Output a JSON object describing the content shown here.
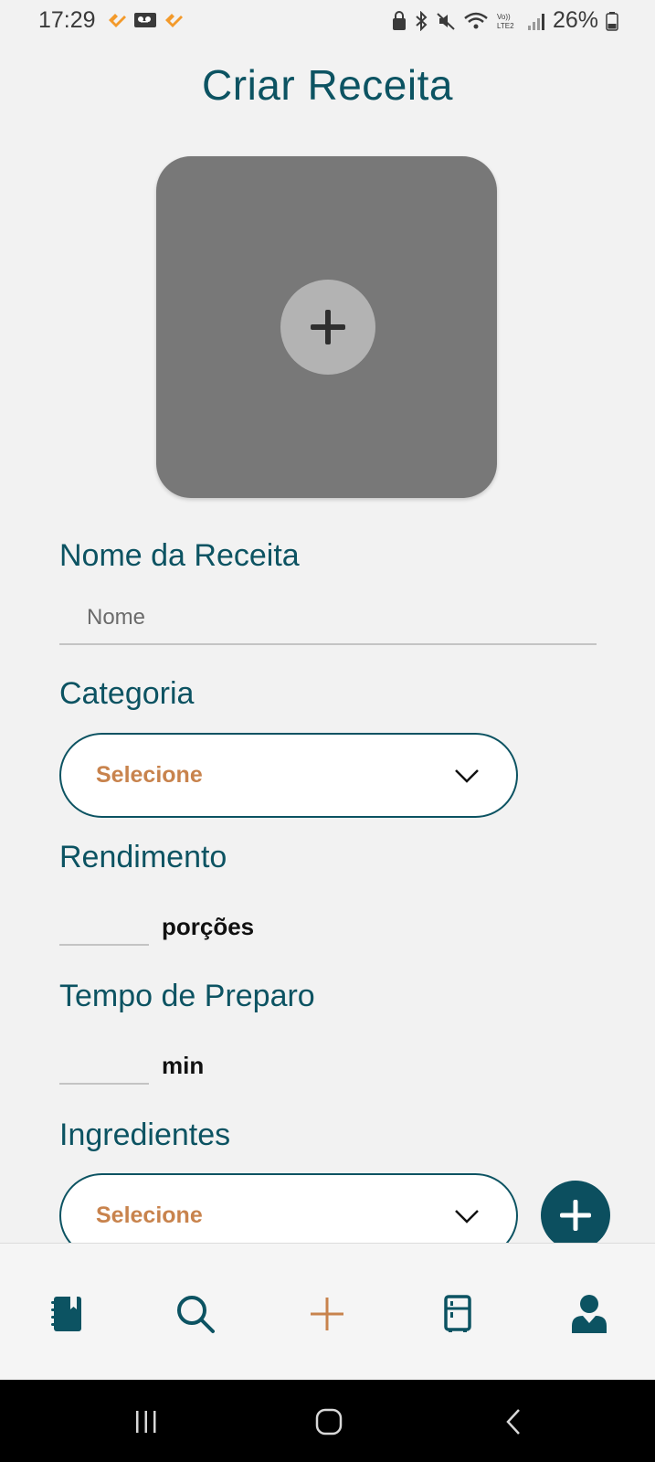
{
  "status_bar": {
    "time": "17:29",
    "battery": "26%"
  },
  "page": {
    "title": "Criar Receita"
  },
  "form": {
    "name_label": "Nome da Receita",
    "name_placeholder": "Nome",
    "category_label": "Categoria",
    "category_select": "Selecione",
    "yield_label": "Rendimento",
    "yield_unit": "porções",
    "prep_time_label": "Tempo de Preparo",
    "prep_time_unit": "min",
    "ingredients_label": "Ingredientes",
    "ingredients_select": "Selecione"
  },
  "bottom_nav": {
    "items": [
      {
        "icon": "recipe-book-icon"
      },
      {
        "icon": "search-icon"
      },
      {
        "icon": "plus-icon",
        "active": true
      },
      {
        "icon": "fridge-icon"
      },
      {
        "icon": "profile-icon"
      }
    ]
  },
  "colors": {
    "primary": "#0c5362",
    "accent": "#c8834d",
    "background": "#f2f2f2",
    "image_placeholder": "#787878"
  }
}
